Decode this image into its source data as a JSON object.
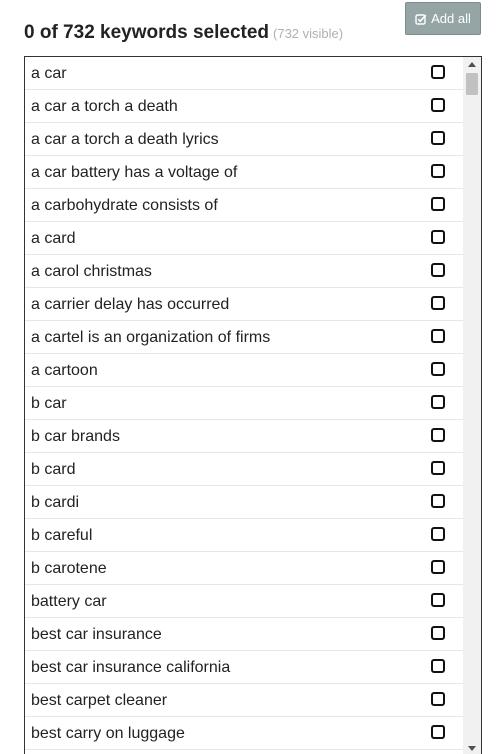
{
  "header": {
    "selected_text": "0 of 732 keywords selected",
    "visible_text": "(732 visible)",
    "add_all_label": "Add all"
  },
  "keywords": [
    "a car",
    "a car a torch a death",
    "a car a torch a death lyrics",
    "a car battery has a voltage of",
    "a carbohydrate consists of",
    "a card",
    "a carol christmas",
    "a carrier delay has occurred",
    "a cartel is an organization of firms",
    "a cartoon",
    "b car",
    "b car brands",
    "b card",
    "b cardi",
    "b careful",
    "b carotene",
    "battery car",
    "best car insurance",
    "best car insurance california",
    "best carpet cleaner",
    "best carry on luggage"
  ],
  "colors": {
    "button_bg": "#95a5a6",
    "muted_text": "#b0b0b0",
    "border": "#333333"
  }
}
